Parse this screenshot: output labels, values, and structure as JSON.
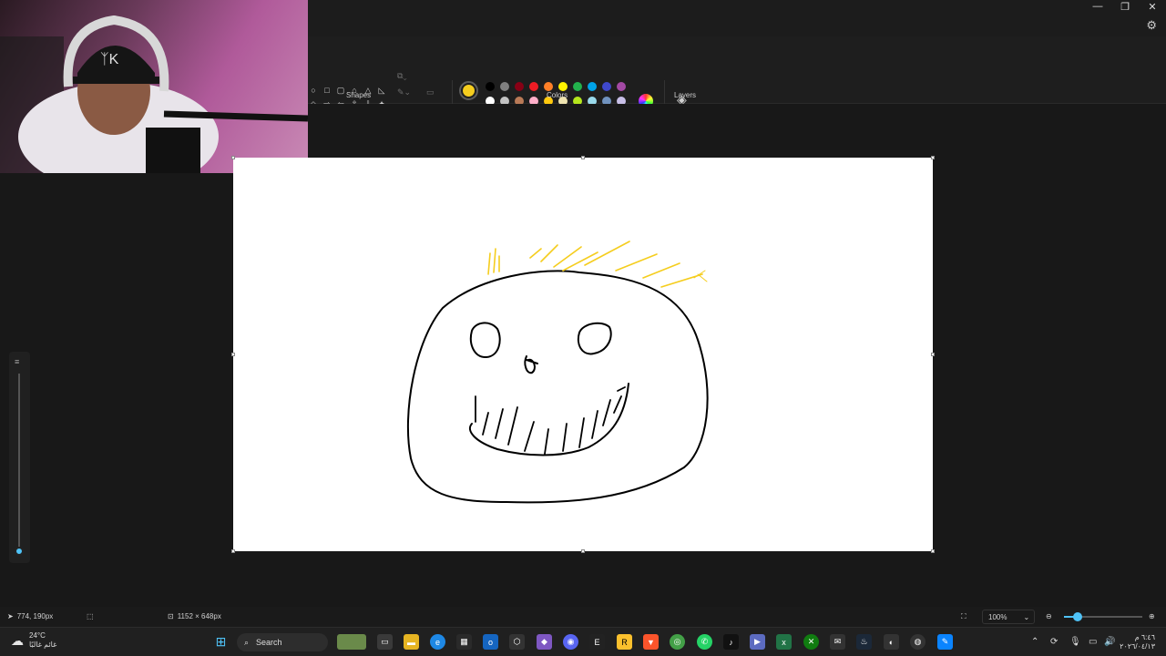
{
  "titlebar": {
    "minimize_glyph": "—",
    "restore_glyph": "❐",
    "close_glyph": "✕",
    "settings_glyph": "⚙"
  },
  "ribbon": {
    "shapes_label": "Shapes",
    "colors_label": "Colors",
    "layers_label": "Layers",
    "shape_glyphs": [
      "○",
      "□",
      "▢",
      "⌂",
      "△",
      "◺",
      "◇",
      "⇨",
      "⇦",
      "⇧",
      "⇩",
      "✦",
      "◇",
      "☐",
      "◯",
      "♡",
      "⌕",
      "✎"
    ],
    "current_color": "#f5cd1e",
    "secondary_color": "#ffffff",
    "palette": [
      "#000000",
      "#7f7f7f",
      "#880015",
      "#ed1c24",
      "#ff7f27",
      "#fff200",
      "#22b14c",
      "#00a2e8",
      "#3f48cc",
      "#a349a4",
      "#ffffff",
      "#c3c3c3",
      "#b97a57",
      "#ffaec9",
      "#ffc90e",
      "#efe4b0",
      "#b5e61d",
      "#99d9ea",
      "#7092be",
      "#c8bfe7"
    ],
    "edit_colors_icon": "color-wheel-icon",
    "layers_icon": "layers-icon"
  },
  "canvas": {
    "background": "#ffffff",
    "stroke_color": "#000000",
    "accent_stroke_color": "#f5cd1e"
  },
  "side_slider": {
    "level": 0.05,
    "accent": "#4fc3f7"
  },
  "statusbar": {
    "cursor_position": "774, 190px",
    "canvas_size": "1152 × 648px",
    "zoom_value": "100%",
    "zoom_level": 0.18
  },
  "taskbar": {
    "temperature": "24°C",
    "weather_desc": "غائم غالبًا",
    "search_label": "Search",
    "time": "٦:٤٦ م",
    "date": "٢٠٢٦/٠٤/١٣"
  }
}
